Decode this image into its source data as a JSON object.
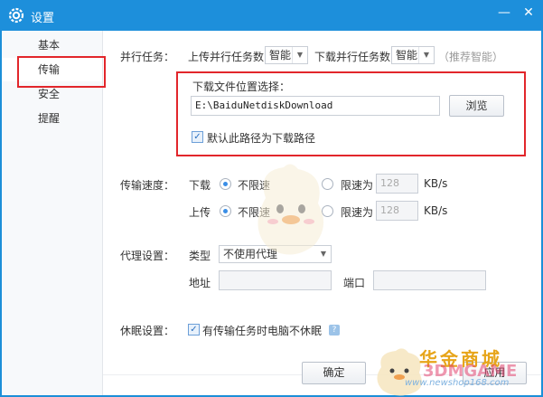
{
  "window": {
    "title": "设置",
    "minimize": "—",
    "close": "✕"
  },
  "sidebar": {
    "items": [
      {
        "label": "基本"
      },
      {
        "label": "传输"
      },
      {
        "label": "安全"
      },
      {
        "label": "提醒"
      }
    ]
  },
  "parallel": {
    "label": "并行任务：",
    "upload_label": "上传并行任务数",
    "upload_value": "智能",
    "download_label": "下载并行任务数",
    "download_value": "智能",
    "hint": "（推荐智能）"
  },
  "location": {
    "label": "下载文件位置选择：",
    "path": "E:\\BaiduNetdiskDownload",
    "browse": "浏览",
    "default_check": "默认此路径为下载路径"
  },
  "speed": {
    "label": "传输速度：",
    "download": "下载",
    "upload": "上传",
    "unlimited": "不限速",
    "limit": "限速为",
    "download_limit_value": "128",
    "upload_limit_value": "128",
    "unit": "KB/s"
  },
  "proxy": {
    "label": "代理设置：",
    "type_label": "类型",
    "type_value": "不使用代理",
    "address_label": "地址",
    "port_label": "端口"
  },
  "sleep": {
    "label": "休眠设置：",
    "check": "有传输任务时电脑不休眠",
    "help": "?"
  },
  "footer": {
    "ok": "确定",
    "apply": "应用"
  },
  "watermark": {
    "text": "华金商城",
    "site": "www.newshop168.com",
    "brand": "3DMGAME"
  },
  "colors": {
    "titlebar": "#1d8fdb",
    "highlight": "#e2262b",
    "accent": "#3a8ee6"
  }
}
